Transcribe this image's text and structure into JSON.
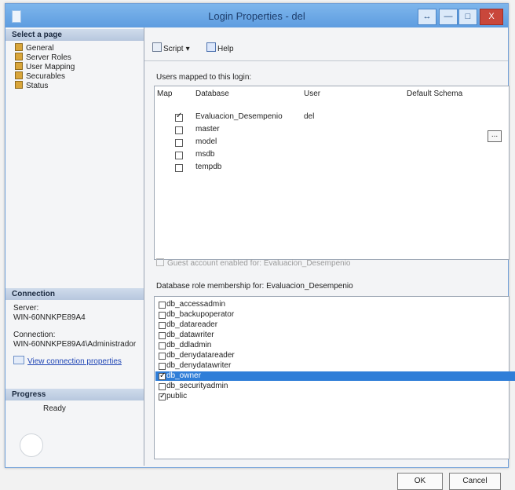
{
  "window": {
    "title": "Login Properties - del",
    "buttons": {
      "restore": "↔",
      "minimize": "—",
      "maximize": "□",
      "close": "X"
    }
  },
  "sidebar": {
    "select_page": "Select a page",
    "items": [
      {
        "label": "General"
      },
      {
        "label": "Server Roles"
      },
      {
        "label": "User Mapping"
      },
      {
        "label": "Securables"
      },
      {
        "label": "Status"
      }
    ],
    "connection": {
      "header": "Connection",
      "server_label": "Server:",
      "server_value": "WIN-60NNKPE89A4",
      "connection_label": "Connection:",
      "connection_value": "WIN-60NNKPE89A4\\Administrador",
      "link_text": "View connection properties"
    },
    "progress": {
      "header": "Progress",
      "status": "Ready"
    }
  },
  "toolbar": {
    "script_label": "Script",
    "help_label": "Help"
  },
  "main": {
    "users_mapped_label": "Users mapped to this login:",
    "columns": [
      "Map",
      "Database",
      "User",
      "Default Schema"
    ],
    "rows": [
      {
        "map": true,
        "database": "Evaluacion_Desempenio",
        "user": "del",
        "default_schema": ""
      },
      {
        "map": false,
        "database": "master",
        "user": "",
        "default_schema": ""
      },
      {
        "map": false,
        "database": "model",
        "user": "",
        "default_schema": ""
      },
      {
        "map": false,
        "database": "msdb",
        "user": "",
        "default_schema": ""
      },
      {
        "map": false,
        "database": "tempdb",
        "user": "",
        "default_schema": ""
      }
    ],
    "guest_account_text": "Guest account enabled for: Evaluacion_Desempenio",
    "role_membership_label": "Database role membership for: Evaluacion_Desempenio",
    "roles": [
      {
        "label": "db_accessadmin",
        "checked": false,
        "selected": false
      },
      {
        "label": "db_backupoperator",
        "checked": false,
        "selected": false
      },
      {
        "label": "db_datareader",
        "checked": false,
        "selected": false
      },
      {
        "label": "db_datawriter",
        "checked": false,
        "selected": false
      },
      {
        "label": "db_ddladmin",
        "checked": false,
        "selected": false
      },
      {
        "label": "db_denydatareader",
        "checked": false,
        "selected": false
      },
      {
        "label": "db_denydatawriter",
        "checked": false,
        "selected": false
      },
      {
        "label": "db_owner",
        "checked": true,
        "selected": true
      },
      {
        "label": "db_securityadmin",
        "checked": false,
        "selected": false
      },
      {
        "label": "public",
        "checked": true,
        "selected": false
      }
    ]
  },
  "actions": {
    "ok": "OK",
    "cancel": "Cancel"
  }
}
